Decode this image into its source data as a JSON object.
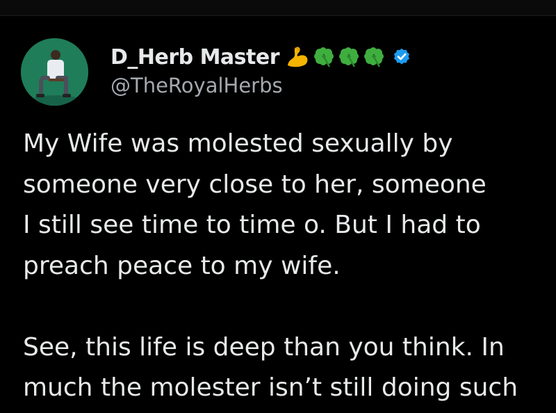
{
  "author": {
    "display_name": "D_Herb Master",
    "handle": "@TheRoyalHerbs",
    "emojis": [
      "flexed-biceps",
      "four-leaf-clover",
      "four-leaf-clover",
      "four-leaf-clover"
    ],
    "verified": true
  },
  "tweet": {
    "paragraph1": [
      "My Wife was molested sexually by",
      "someone very close to her, someone",
      "I still see time to time o. But I had to",
      "preach peace to my wife."
    ],
    "paragraph2": [
      "See, this life is deep than you think. In",
      "much the molester isn’t still doing such"
    ]
  },
  "colors": {
    "background": "#000000",
    "text": "#e7e9ea",
    "handle": "#a4a9ae",
    "verified": "#1d9bf0",
    "clover": "#3fae3f",
    "biceps": "#f5b400"
  }
}
